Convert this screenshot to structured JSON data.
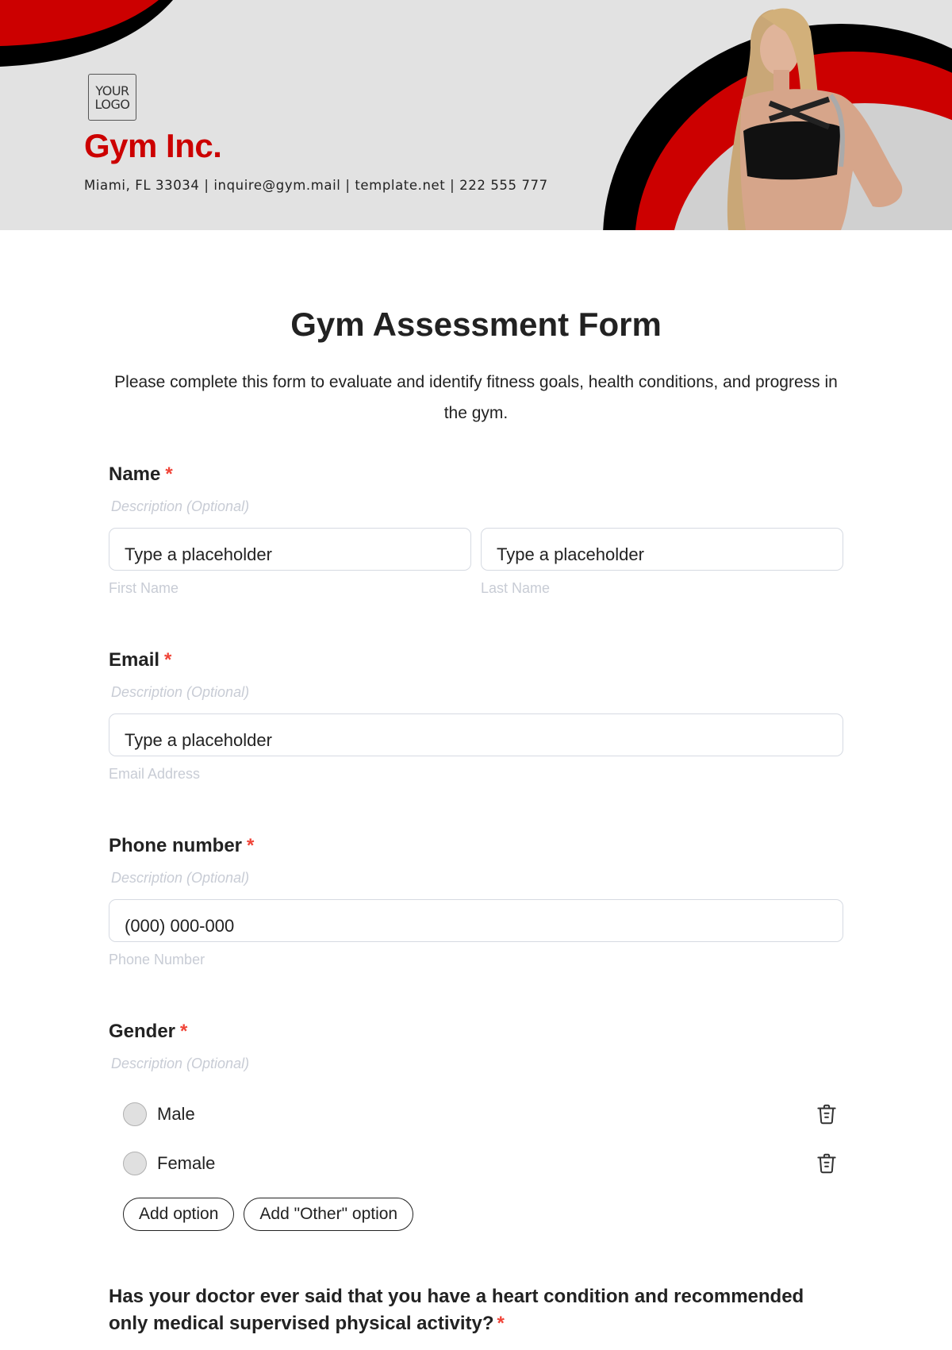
{
  "header": {
    "logo_line1": "YOUR",
    "logo_line2": "LOGO",
    "company_name": "Gym Inc.",
    "contact": "Miami, FL 33034 | inquire@gym.mail | template.net | 222 555 777",
    "colors": {
      "brand_red": "#cc0000",
      "black": "#000000",
      "background": "#e2e2e2"
    }
  },
  "form": {
    "title": "Gym Assessment Form",
    "subtitle": "Please complete this form to evaluate and identify fitness goals, health conditions, and progress in the gym.",
    "required_marker": "*",
    "questions": [
      {
        "label": "Name",
        "description": "Description (Optional)",
        "inputs": [
          {
            "value": "Type a placeholder",
            "helper": "First Name"
          },
          {
            "value": "Type a placeholder",
            "helper": "Last Name"
          }
        ]
      },
      {
        "label": "Email",
        "description": "Description (Optional)",
        "inputs": [
          {
            "value": "Type a placeholder",
            "helper": "Email Address"
          }
        ]
      },
      {
        "label": "Phone number",
        "description": "Description (Optional)",
        "inputs": [
          {
            "value": "(000) 000-000",
            "helper": "Phone Number"
          }
        ]
      },
      {
        "label": "Gender",
        "description": "Description (Optional)",
        "options": [
          {
            "label": "Male",
            "delete_icon": "trash-icon"
          },
          {
            "label": "Female",
            "delete_icon": "trash-icon"
          }
        ],
        "add_option_label": "Add option",
        "add_other_label": "Add \"Other\" option"
      },
      {
        "label": "Has your doctor ever said that you have a heart condition and recommended only medical supervised physical activity?"
      }
    ]
  }
}
